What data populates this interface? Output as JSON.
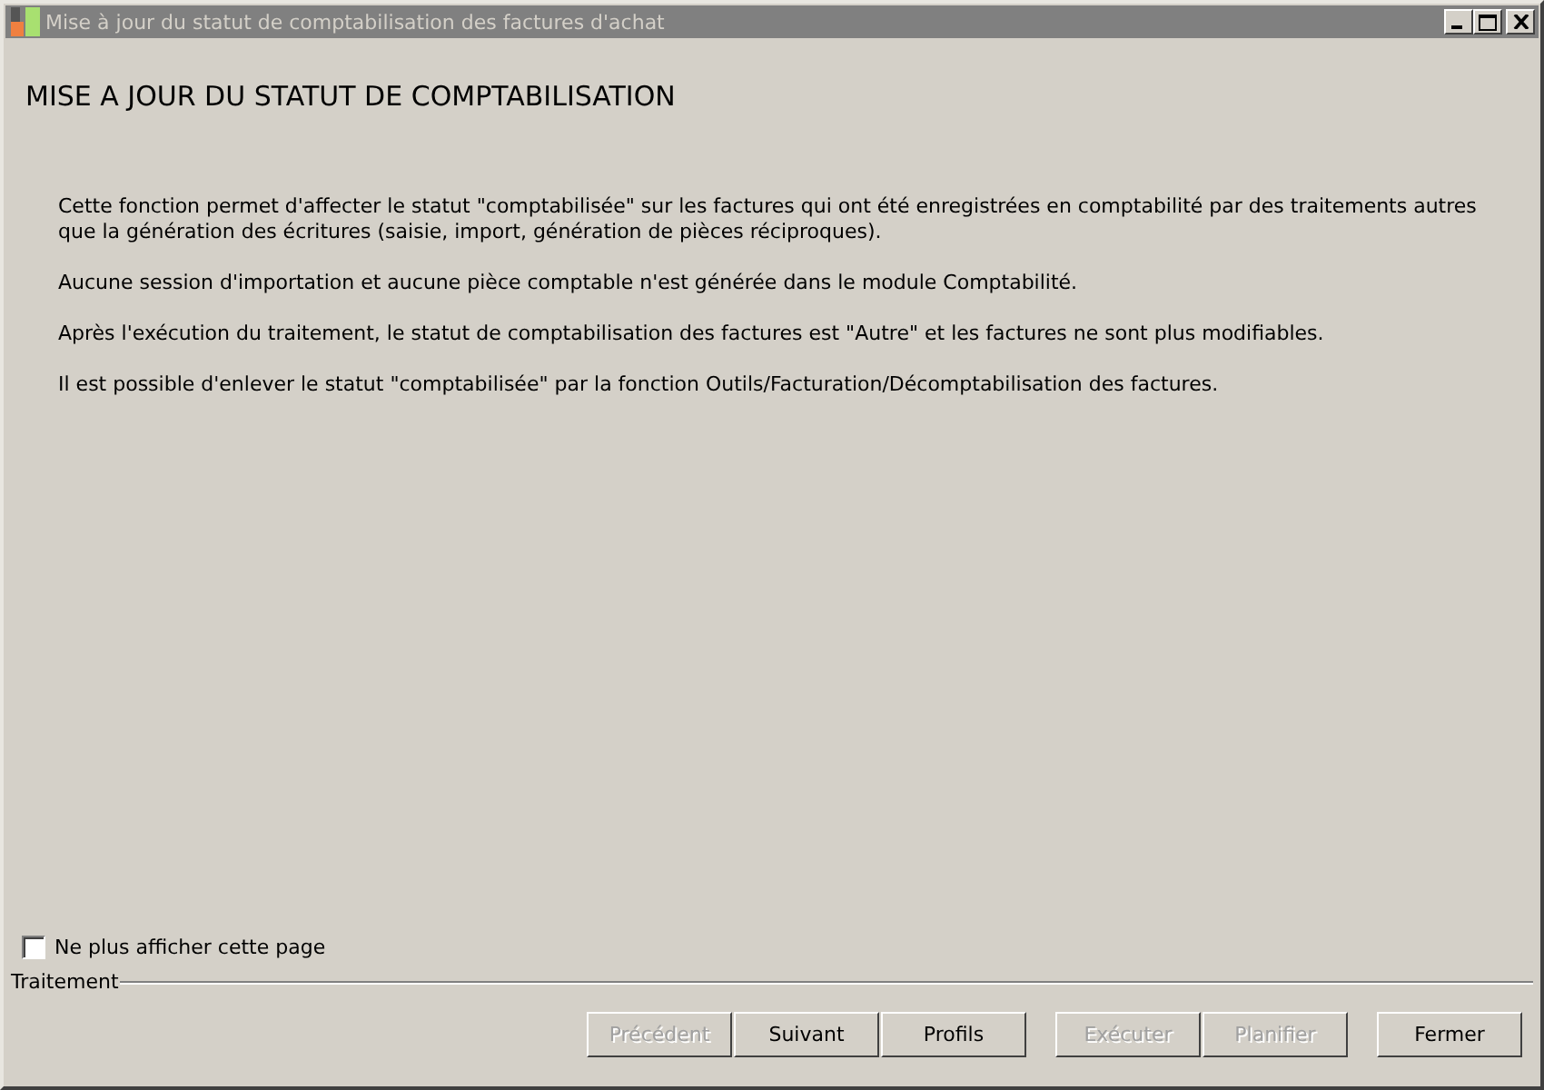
{
  "window": {
    "title": "Mise à jour du statut de comptabilisation des factures d'achat",
    "active": false
  },
  "heading": "MISE A JOUR DU STATUT DE COMPTABILISATION",
  "paragraphs": [
    "Cette fonction permet d'affecter le statut \"comptabilisée\" sur les factures qui ont été enregistrées en comptabilité par des traitements autres que la génération des écritures (saisie, import, génération de pièces réciproques).",
    "Aucune session d'importation et aucune pièce comptable n'est générée dans le module Comptabilité.",
    "Après l'exécution du traitement, le statut de comptabilisation des factures est \"Autre\" et les factures ne sont plus modifiables.",
    "Il est possible d'enlever le statut \"comptabilisée\" par la fonction Outils/Facturation/Décomptabilisation des factures."
  ],
  "dont_show_again": {
    "label": "Ne plus afficher cette page",
    "checked": false
  },
  "group_label": "Traitement",
  "button_groups": [
    [
      {
        "label": "Précédent",
        "disabled": true
      },
      {
        "label": "Suivant",
        "disabled": false
      },
      {
        "label": "Profils",
        "disabled": false
      }
    ],
    [
      {
        "label": "Exécuter",
        "disabled": true
      },
      {
        "label": "Planifier",
        "disabled": true
      }
    ],
    [
      {
        "label": "Fermer",
        "disabled": false
      }
    ]
  ]
}
